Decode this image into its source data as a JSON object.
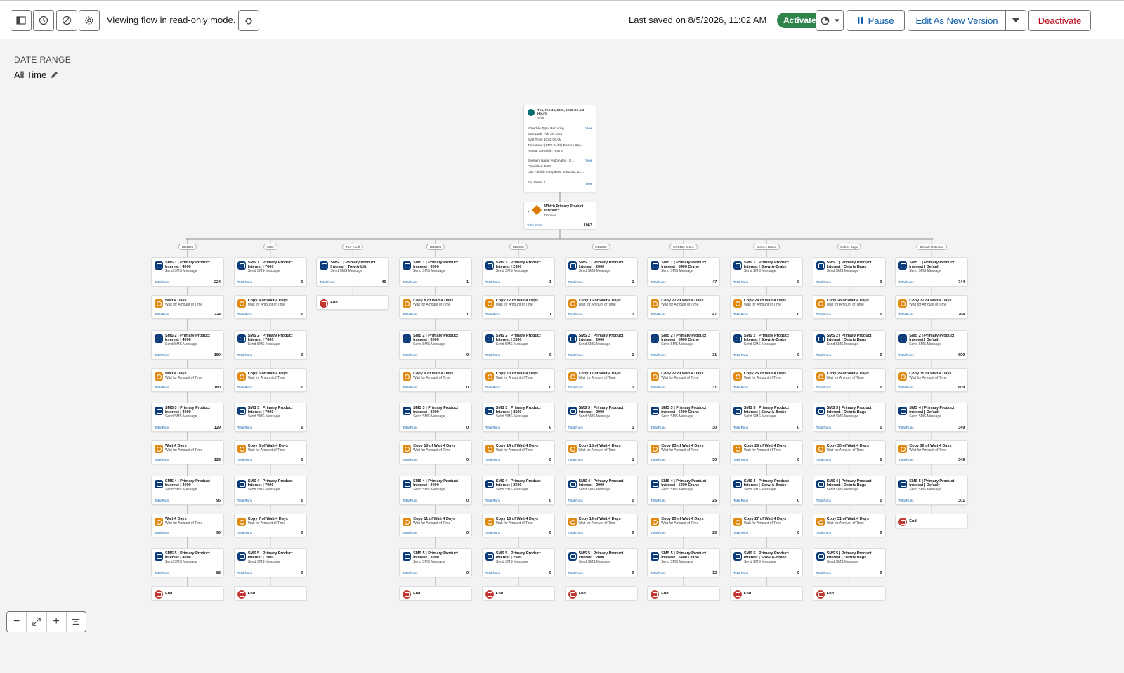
{
  "toolbar": {
    "read_only_text": "Viewing flow in read-only mode.",
    "last_saved": "Last saved on 8/5/2026, 11:02 AM",
    "status": "Activated",
    "pause": "Pause",
    "edit_new_version": "Edit As New Version",
    "deactivate": "Deactivate"
  },
  "date_range": {
    "label": "DATE RANGE",
    "value": "All Time"
  },
  "start": {
    "title": "Thu, Feb 19, 2026, 10:02:00 AM, Hourly",
    "subtitle": "Start",
    "schedule_type": "Schedule Type: Recurring",
    "start_date": "Start Date: Feb 19, 2026",
    "start_time": "Start Time: 10:02:00 AM",
    "time_zone": "Time Zone: (GMT-04:00) Eastern Day...",
    "repeat": "Repeat Schedule: Hourly",
    "segment": "Segment Name: Automated - E...",
    "population": "Population: 5399",
    "last_publish": "Last Publish Completed: 8/5/2026, 10:...",
    "exit_rules": "Exit Rules: 2",
    "view": "View"
  },
  "decision": {
    "title": "Which Primary Product Interest?",
    "subtitle": "Decision",
    "runs_label": "Total Runs",
    "runs": "1063"
  },
  "labels": {
    "runs": "Total Runs",
    "sms_sub": "Send SMS Message",
    "wait_sub": "Wait for Amount of Time",
    "end": "End"
  },
  "branches": [
    {
      "name": "RB4000",
      "nodes": [
        {
          "k": "sms",
          "t": "SMS 1 | Primary Product Interest | 4000",
          "r": "224"
        },
        {
          "k": "wait",
          "t": "Wait 4 Days",
          "r": "224"
        },
        {
          "k": "sms",
          "t": "SMS 2 | Primary Product Interest | 4000",
          "r": "180"
        },
        {
          "k": "wait",
          "t": "Wait 4 Days",
          "r": "180"
        },
        {
          "k": "sms",
          "t": "SMS 3 | Primary Product Interest | 4000",
          "r": "129"
        },
        {
          "k": "wait",
          "t": "Wait 4 Days",
          "r": "129"
        },
        {
          "k": "sms",
          "t": "SMS 4 | Primary Product Interest | 4000",
          "r": "96"
        },
        {
          "k": "wait",
          "t": "Wait 4 Days",
          "r": "96"
        },
        {
          "k": "sms",
          "t": "SMS 5 | Primary Product Interest | 4000",
          "r": "88"
        },
        {
          "k": "end",
          "t": "End"
        }
      ]
    },
    {
      "name": "7000",
      "nodes": [
        {
          "k": "sms",
          "t": "SMS 1 | Primary Product Interest | 7000",
          "r": "0"
        },
        {
          "k": "wait",
          "t": "Copy 4 of Wait 4 Days",
          "r": "0"
        },
        {
          "k": "sms",
          "t": "SMS 2 | Primary Product Interest | 7000",
          "r": "0"
        },
        {
          "k": "wait",
          "t": "Copy 5 of Wait 4 Days",
          "r": "0"
        },
        {
          "k": "sms",
          "t": "SMS 3 | Primary Product Interest | 7000",
          "r": "0"
        },
        {
          "k": "wait",
          "t": "Copy 6 of Wait 4 Days",
          "r": "0"
        },
        {
          "k": "sms",
          "t": "SMS 4 | Primary Product Interest | 7000",
          "r": "0"
        },
        {
          "k": "wait",
          "t": "Copy 7 of Wait 4 Days",
          "r": "0"
        },
        {
          "k": "sms",
          "t": "SMS 5 | Primary Product Interest | 7000",
          "r": "0"
        },
        {
          "k": "end",
          "t": "End"
        }
      ]
    },
    {
      "name": "Tow-A-Lift",
      "nodes": [
        {
          "k": "sms",
          "t": "SMS 1 | Primary Product Interest | Tow-A-Lift",
          "r": "45"
        },
        {
          "k": "end",
          "t": "End"
        }
      ]
    },
    {
      "name": "RB3000",
      "nodes": [
        {
          "k": "sms",
          "t": "SMS 1 | Primary Product Interest | 3000",
          "r": "1"
        },
        {
          "k": "wait",
          "t": "Copy 8 of Wait 4 Days",
          "r": "1"
        },
        {
          "k": "sms",
          "t": "SMS 2 | Primary Product Interest | 3000",
          "r": "0"
        },
        {
          "k": "wait",
          "t": "Copy 9 of Wait 4 Days",
          "r": "0"
        },
        {
          "k": "sms",
          "t": "SMS 3 | Primary Product Interest | 3000",
          "r": "0"
        },
        {
          "k": "wait",
          "t": "Copy 10 of Wait 4 Days",
          "r": "0"
        },
        {
          "k": "sms",
          "t": "SMS 4 | Primary Product Interest | 3000",
          "r": "0"
        },
        {
          "k": "wait",
          "t": "Copy 11 of Wait 4 Days",
          "r": "0"
        },
        {
          "k": "sms",
          "t": "SMS 5 | Primary Product Interest | 3000",
          "r": "0"
        },
        {
          "k": "end",
          "t": "End"
        }
      ]
    },
    {
      "name": "RB2500",
      "nodes": [
        {
          "k": "sms",
          "t": "SMS 1 | Primary Product Interest | 2500",
          "r": "1"
        },
        {
          "k": "wait",
          "t": "Copy 12 of Wait 4 Days",
          "r": "1"
        },
        {
          "k": "sms",
          "t": "SMS 2 | Primary Product Interest | 2500",
          "r": "0"
        },
        {
          "k": "wait",
          "t": "Copy 13 of Wait 4 Days",
          "r": "0"
        },
        {
          "k": "sms",
          "t": "SMS 3 | Primary Product Interest | 2500",
          "r": "0"
        },
        {
          "k": "wait",
          "t": "Copy 14 of Wait 4 Days",
          "r": "0"
        },
        {
          "k": "sms",
          "t": "SMS 4 | Primary Product Interest | 2500",
          "r": "0"
        },
        {
          "k": "wait",
          "t": "Copy 15 of Wait 4 Days",
          "r": "0"
        },
        {
          "k": "sms",
          "t": "SMS 5 | Primary Product Interest | 2500",
          "r": "0"
        },
        {
          "k": "end",
          "t": "End"
        }
      ]
    },
    {
      "name": "RB2000",
      "nodes": [
        {
          "k": "sms",
          "t": "SMS 1 | Primary Product Interest | 2000",
          "r": "1"
        },
        {
          "k": "wait",
          "t": "Copy 16 of Wait 4 Days",
          "r": "1"
        },
        {
          "k": "sms",
          "t": "SMS 2 | Primary Product Interest | 2000",
          "r": "1"
        },
        {
          "k": "wait",
          "t": "Copy 17 of Wait 4 Days",
          "r": "1"
        },
        {
          "k": "sms",
          "t": "SMS 3 | Primary Product Interest | 2000",
          "r": "1"
        },
        {
          "k": "wait",
          "t": "Copy 18 of Wait 4 Days",
          "r": "1"
        },
        {
          "k": "sms",
          "t": "SMS 4 | Primary Product Interest | 2000",
          "r": "0"
        },
        {
          "k": "wait",
          "t": "Copy 19 of Wait 4 Days",
          "r": "0"
        },
        {
          "k": "sms",
          "t": "SMS 5 | Primary Product Interest | 2000",
          "r": "0"
        },
        {
          "k": "end",
          "t": "End"
        }
      ]
    },
    {
      "name": "CR5400 Crane",
      "nodes": [
        {
          "k": "sms",
          "t": "SMS 1 | Primary Product Interest | 5400 Crane",
          "r": "47"
        },
        {
          "k": "wait",
          "t": "Copy 21 of Wait 4 Days",
          "r": "47"
        },
        {
          "k": "sms",
          "t": "SMS 2 | Primary Product Interest | 5400 Crane",
          "r": "31"
        },
        {
          "k": "wait",
          "t": "Copy 22 of Wait 4 Days",
          "r": "31"
        },
        {
          "k": "sms",
          "t": "SMS 3 | Primary Product Interest | 5400 Crane",
          "r": "30"
        },
        {
          "k": "wait",
          "t": "Copy 23 of Wait 4 Days",
          "r": "30"
        },
        {
          "k": "sms",
          "t": "SMS 4 | Primary Product Interest | 5400 Crane",
          "r": "25"
        },
        {
          "k": "wait",
          "t": "Copy 20 of Wait 4 Days",
          "r": "25"
        },
        {
          "k": "sms",
          "t": "SMS 5 | Primary Product Interest | 5400 Crane",
          "r": "12"
        },
        {
          "k": "end",
          "t": "End"
        }
      ]
    },
    {
      "name": "Stow-A-Brake",
      "nodes": [
        {
          "k": "sms",
          "t": "SMS 1 | Primary Product Interest | Stow-A-Brake",
          "r": "0"
        },
        {
          "k": "wait",
          "t": "Copy 24 of Wait 4 Days",
          "r": "0"
        },
        {
          "k": "sms",
          "t": "SMS 2 | Primary Product Interest | Stow-A-Brake",
          "r": "0"
        },
        {
          "k": "wait",
          "t": "Copy 25 of Wait 4 Days",
          "r": "0"
        },
        {
          "k": "sms",
          "t": "SMS 3 | Primary Product Interest | Stow-A-Brake",
          "r": "0"
        },
        {
          "k": "wait",
          "t": "Copy 26 of Wait 4 Days",
          "r": "0"
        },
        {
          "k": "sms",
          "t": "SMS 4 | Primary Product Interest | Stow-A-Brake",
          "r": "0"
        },
        {
          "k": "wait",
          "t": "Copy 27 of Wait 4 Days",
          "r": "0"
        },
        {
          "k": "sms",
          "t": "SMS 5 | Primary Product Interest | Stow-A-Brake",
          "r": "0"
        },
        {
          "k": "end",
          "t": "End"
        }
      ]
    },
    {
      "name": "Debris Bags",
      "nodes": [
        {
          "k": "sms",
          "t": "SMS 1 | Primary Product Interest | Debris Bags",
          "r": "0"
        },
        {
          "k": "wait",
          "t": "Copy 28 of Wait 4 Days",
          "r": "0"
        },
        {
          "k": "sms",
          "t": "SMS 2 | Primary Product Interest | Debris Bags",
          "r": "0"
        },
        {
          "k": "wait",
          "t": "Copy 29 of Wait 4 Days",
          "r": "0"
        },
        {
          "k": "sms",
          "t": "SMS 3 | Primary Product Interest | Debris Bags",
          "r": "0"
        },
        {
          "k": "wait",
          "t": "Copy 30 of Wait 4 Days",
          "r": "0"
        },
        {
          "k": "sms",
          "t": "SMS 4 | Primary Product Interest | Debris Bags",
          "r": "0"
        },
        {
          "k": "wait",
          "t": "Copy 31 of Wait 4 Days",
          "r": "0"
        },
        {
          "k": "sms",
          "t": "SMS 5 | Primary Product Interest | Debris Bags",
          "r": "0"
        },
        {
          "k": "end",
          "t": "End"
        }
      ]
    },
    {
      "name": "Default Outcome",
      "nodes": [
        {
          "k": "sms",
          "t": "SMS 1 | Primary Product Interest | Default",
          "r": "744"
        },
        {
          "k": "wait",
          "t": "Copy 32 of Wait 4 Days",
          "r": "764"
        },
        {
          "k": "sms",
          "t": "SMS 2 | Primary Product Interest | Default",
          "r": "609"
        },
        {
          "k": "wait",
          "t": "Copy 35 of Wait 4 Days",
          "r": "609"
        },
        {
          "k": "sms",
          "t": "SMS 4 | Primary Product Interest | Default",
          "r": "349"
        },
        {
          "k": "wait",
          "t": "Copy 36 of Wait 4 Days",
          "r": "349"
        },
        {
          "k": "sms",
          "t": "SMS 5 | Primary Product Interest | Default",
          "r": "301"
        },
        {
          "k": "end",
          "t": "End"
        }
      ]
    }
  ]
}
